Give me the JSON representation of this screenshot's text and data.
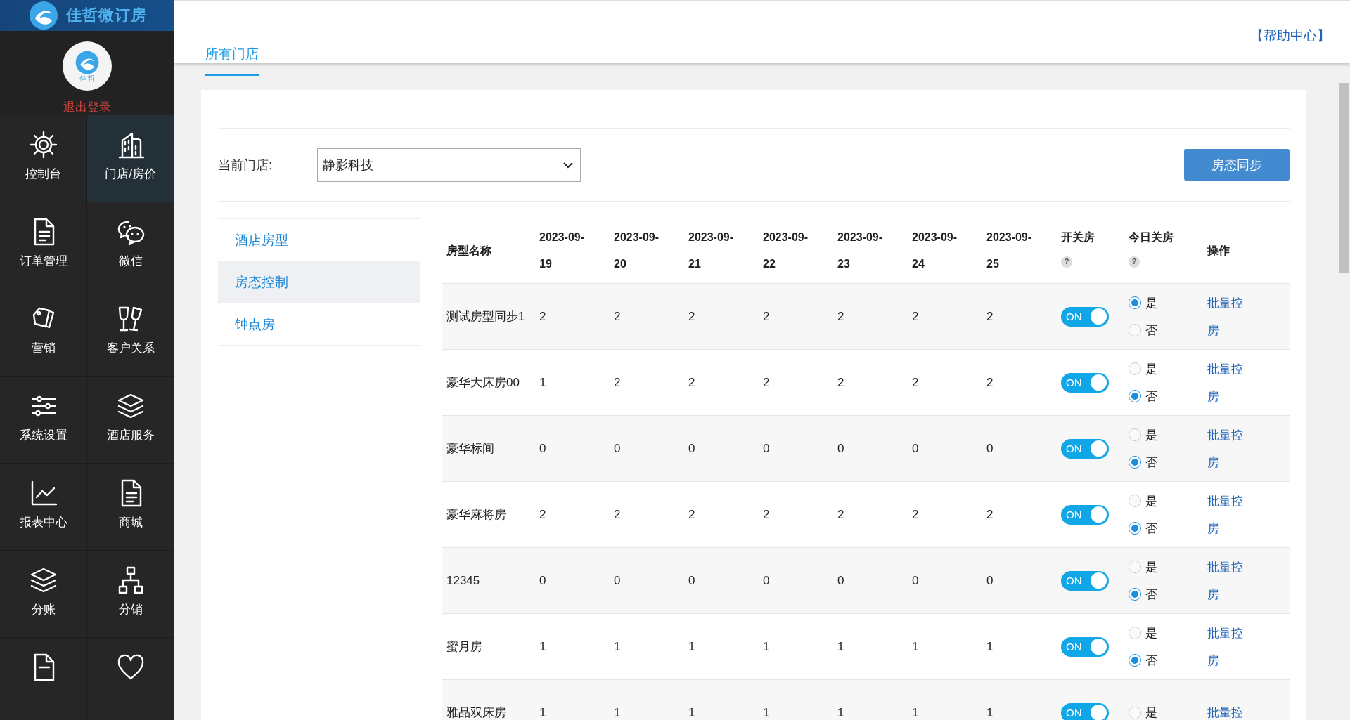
{
  "brand": {
    "name": "佳哲微订房"
  },
  "profile": {
    "avatar_text": "佳 哲",
    "logout": "退出登录"
  },
  "nav": [
    {
      "label": "控制台",
      "selected": false
    },
    {
      "label": "门店/房价",
      "selected": true
    },
    {
      "label": "订单管理",
      "selected": false
    },
    {
      "label": "微信",
      "selected": false
    },
    {
      "label": "营销",
      "selected": false
    },
    {
      "label": "客户关系",
      "selected": false
    },
    {
      "label": "系统设置",
      "selected": false
    },
    {
      "label": "酒店服务",
      "selected": false
    },
    {
      "label": "报表中心",
      "selected": false
    },
    {
      "label": "商城",
      "selected": false
    },
    {
      "label": "分账",
      "selected": false
    },
    {
      "label": "分销",
      "selected": false
    },
    {
      "selected": false
    },
    {
      "selected": false
    }
  ],
  "tabs": [
    {
      "label": "所有门店",
      "selected": true
    }
  ],
  "help_link": "【帮助中心】",
  "store": {
    "label": "当前门店:",
    "value": "静影科技"
  },
  "sync_button": "房态同步",
  "submenu": [
    {
      "label": "酒店房型",
      "selected": false
    },
    {
      "label": "房态控制",
      "selected": true
    },
    {
      "label": "钟点房",
      "selected": false
    }
  ],
  "table": {
    "columns": [
      {
        "label": "房型名称"
      },
      {
        "label": "2023-09-19"
      },
      {
        "label": "2023-09-20"
      },
      {
        "label": "2023-09-21"
      },
      {
        "label": "2023-09-22"
      },
      {
        "label": "2023-09-23"
      },
      {
        "label": "2023-09-24"
      },
      {
        "label": "2023-09-25"
      },
      {
        "label": "开关房",
        "help": "?"
      },
      {
        "label": "今日关房",
        "help": "?"
      },
      {
        "label": "操作"
      }
    ],
    "rows": [
      {
        "name": "测试房型同步1",
        "counts": [
          "2",
          "2",
          "2",
          "2",
          "2",
          "2",
          "2"
        ],
        "on": true,
        "switch_label": "ON",
        "options": [
          {
            "label": "是",
            "selected": true
          },
          {
            "label": "否",
            "selected": false
          }
        ],
        "action": "批量控房"
      },
      {
        "name": "豪华大床房00",
        "counts": [
          "1",
          "2",
          "2",
          "2",
          "2",
          "2",
          "2"
        ],
        "on": true,
        "switch_label": "ON",
        "options": [
          {
            "label": "是",
            "selected": false
          },
          {
            "label": "否",
            "selected": true
          }
        ],
        "action": "批量控房"
      },
      {
        "name": "豪华标间",
        "counts": [
          "0",
          "0",
          "0",
          "0",
          "0",
          "0",
          "0"
        ],
        "on": true,
        "switch_label": "ON",
        "options": [
          {
            "label": "是",
            "selected": false
          },
          {
            "label": "否",
            "selected": true
          }
        ],
        "action": "批量控房"
      },
      {
        "name": "豪华麻将房",
        "counts": [
          "2",
          "2",
          "2",
          "2",
          "2",
          "2",
          "2"
        ],
        "on": true,
        "switch_label": "ON",
        "options": [
          {
            "label": "是",
            "selected": false
          },
          {
            "label": "否",
            "selected": true
          }
        ],
        "action": "批量控房"
      },
      {
        "name": "12345",
        "counts": [
          "0",
          "0",
          "0",
          "0",
          "0",
          "0",
          "0"
        ],
        "on": true,
        "switch_label": "ON",
        "options": [
          {
            "label": "是",
            "selected": false
          },
          {
            "label": "否",
            "selected": true
          }
        ],
        "action": "批量控房"
      },
      {
        "name": "蜜月房",
        "counts": [
          "1",
          "1",
          "1",
          "1",
          "1",
          "1",
          "1"
        ],
        "on": true,
        "switch_label": "ON",
        "options": [
          {
            "label": "是",
            "selected": false
          },
          {
            "label": "否",
            "selected": true
          }
        ],
        "action": "批量控房"
      },
      {
        "name": "雅品双床房",
        "counts": [
          "1",
          "1",
          "1",
          "1",
          "1",
          "1",
          "1"
        ],
        "on": true,
        "switch_label": "ON",
        "options": [
          {
            "label": "是",
            "selected": false
          }
        ],
        "action": "批量控"
      }
    ]
  }
}
